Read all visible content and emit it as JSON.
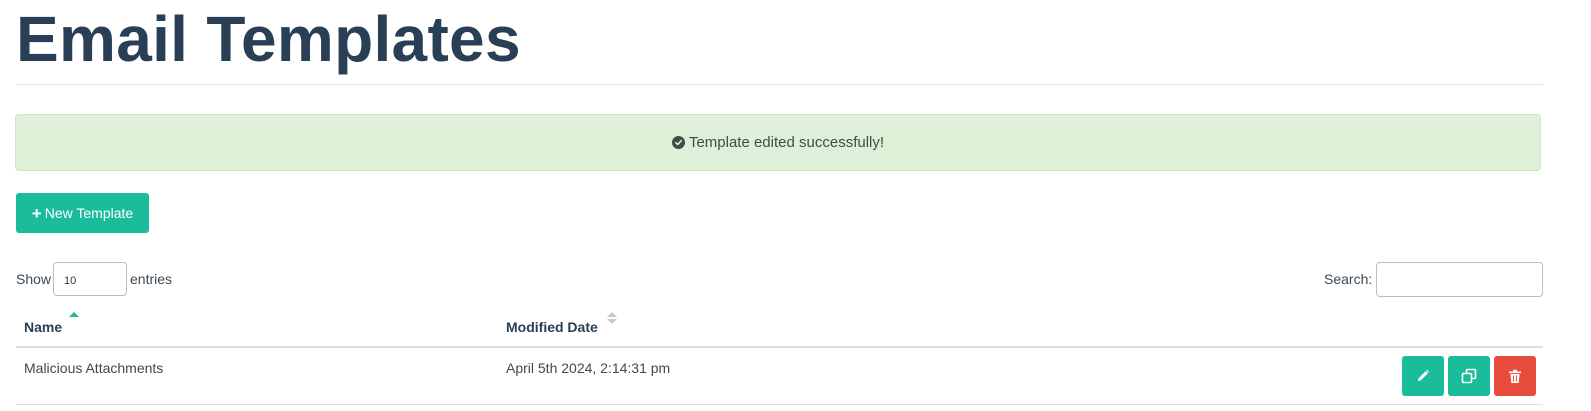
{
  "page": {
    "title": "Email Templates"
  },
  "alert": {
    "icon": "check-circle-icon",
    "message": "Template edited successfully!"
  },
  "toolbar": {
    "new_template_label": "New Template",
    "new_template_icon": "plus-icon"
  },
  "table_controls": {
    "show_label": "Show",
    "entries_value": "10",
    "entries_label": "entries",
    "search_label": "Search:",
    "search_value": ""
  },
  "table": {
    "columns": [
      {
        "label": "Name",
        "sort": "ascending"
      },
      {
        "label": "Modified Date",
        "sort": "none"
      }
    ],
    "rows": [
      {
        "name": "Malicious Attachments",
        "modified_date": "April 5th 2024, 2:14:31 pm",
        "actions": [
          "pencil-icon",
          "copy-icon",
          "trash-icon"
        ]
      }
    ]
  },
  "colors": {
    "accent": "#1abc9c",
    "danger": "#e74c3c",
    "alert_background": "#dff0d8",
    "title": "#283f55"
  }
}
